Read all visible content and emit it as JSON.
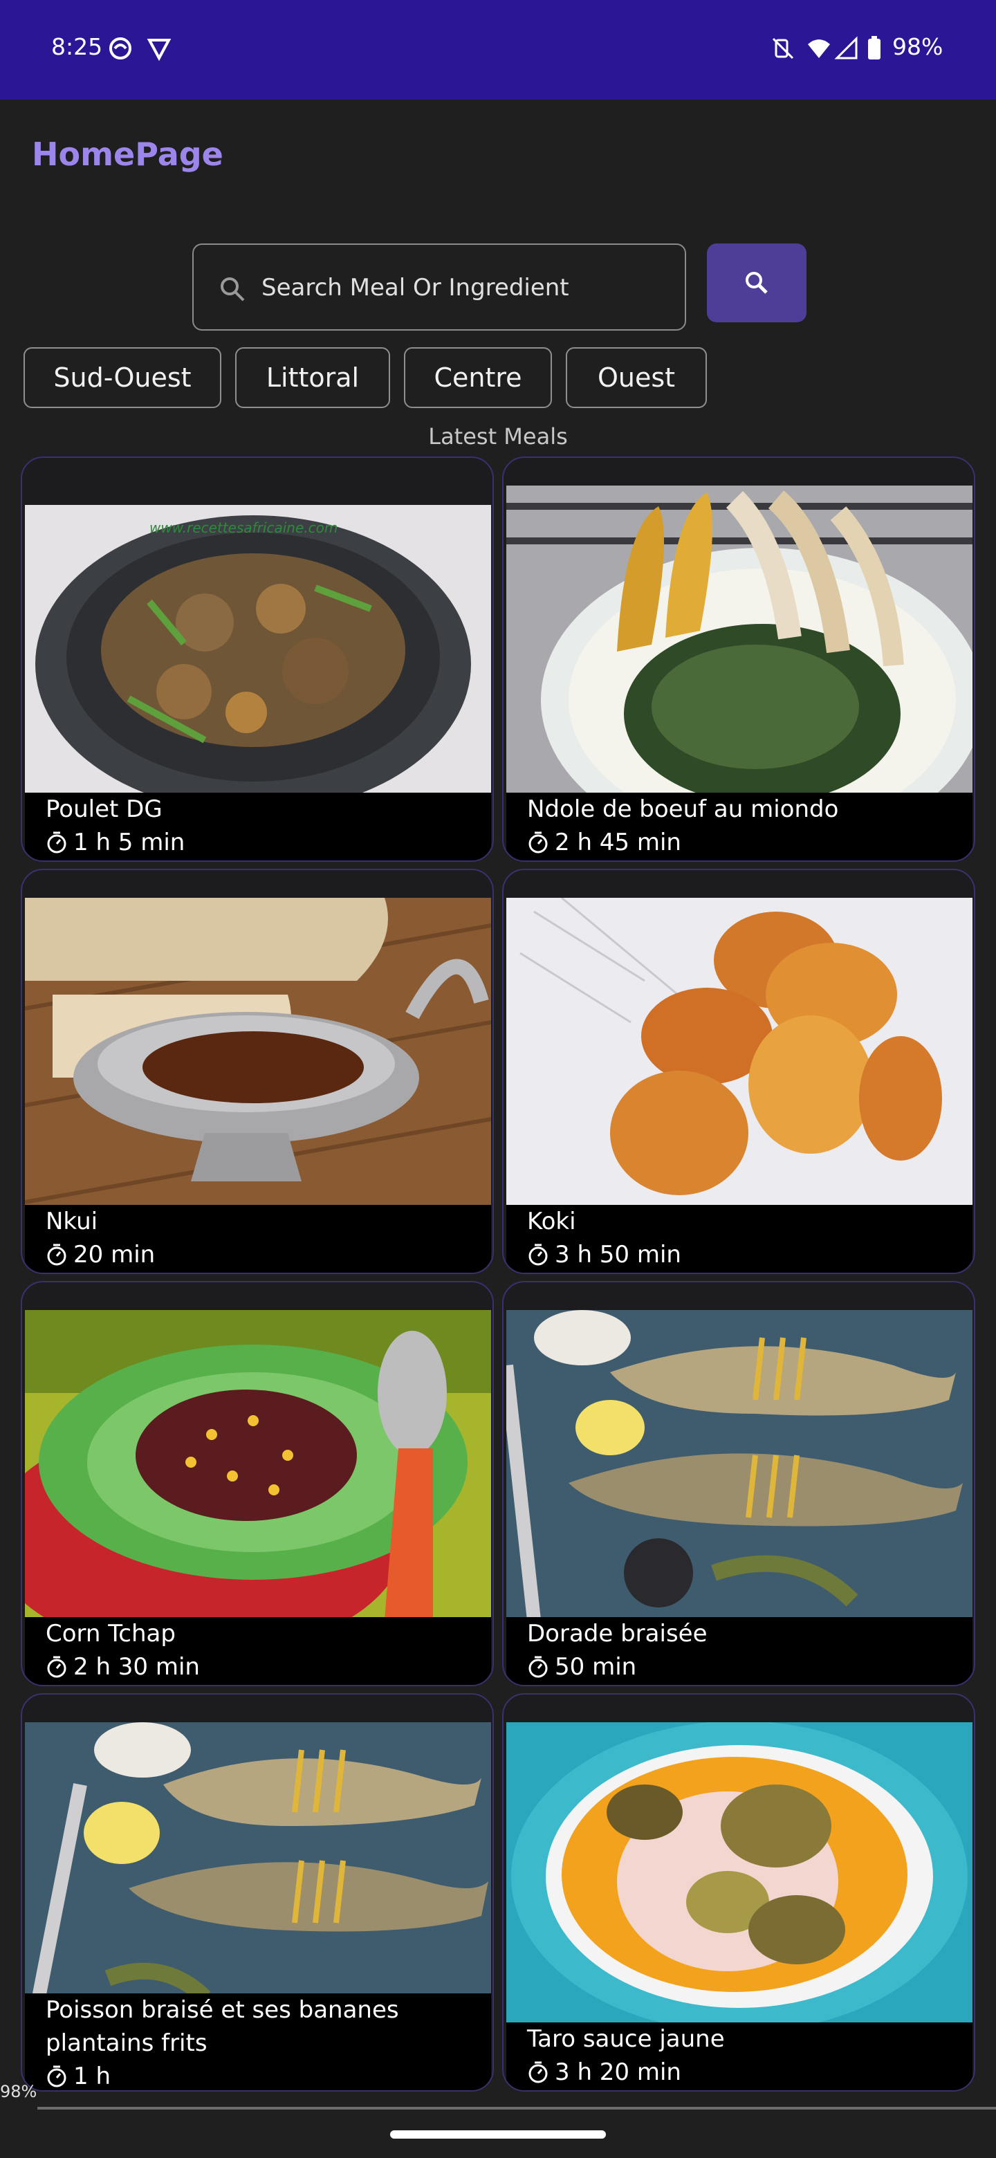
{
  "status_bar": {
    "time": "8:25",
    "battery": "98%",
    "icons": [
      "app-notification-icon",
      "vpn-icon",
      "mute-icon",
      "wifi-icon",
      "signal-icon",
      "battery-icon"
    ]
  },
  "header": {
    "title": "HomePage"
  },
  "search": {
    "placeholder": "Search Meal Or Ingredient",
    "value": ""
  },
  "regions": [
    "Sud-Ouest",
    "Littoral",
    "Centre",
    "Ouest"
  ],
  "section_label": "Latest Meals",
  "meals": [
    {
      "name": "Poulet DG",
      "duration": "1 h 5 min"
    },
    {
      "name": "Ndole de boeuf au miondo",
      "duration": "2 h 45 min"
    },
    {
      "name": "Nkui",
      "duration": "20 min"
    },
    {
      "name": "Koki",
      "duration": "3 h 50 min"
    },
    {
      "name": "Corn Tchap",
      "duration": "2 h 30 min"
    },
    {
      "name": "Dorade braisée",
      "duration": "50 min"
    },
    {
      "name": "Poisson braisé et ses bananes plantains frits",
      "duration": "1 h"
    },
    {
      "name": "Taro sauce jaune",
      "duration": "3 h 20 min"
    }
  ],
  "image_watermark": "www.recettesafricaine.com",
  "footer": {
    "zoom_badge": "98%"
  },
  "colors": {
    "status_bar": "#2b1696",
    "background": "#1f1f20",
    "title": "#9c86ec",
    "search_button": "#4f3e98",
    "card_border": "#3a3070"
  }
}
